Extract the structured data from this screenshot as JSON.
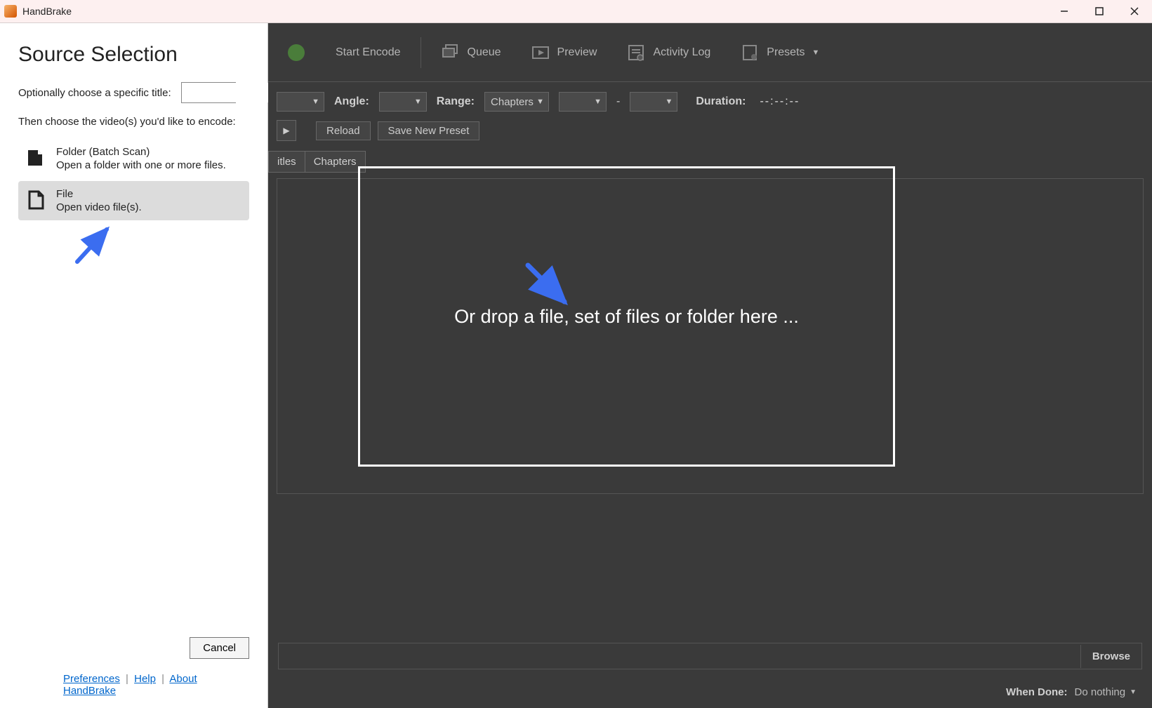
{
  "titlebar": {
    "title": "HandBrake"
  },
  "source": {
    "heading": "Source Selection",
    "title_label": "Optionally choose a specific title:",
    "instruction": "Then choose the video(s) you'd like to encode:",
    "folder": {
      "title": "Folder (Batch Scan)",
      "sub": "Open a folder with one or more files."
    },
    "file": {
      "title": "File",
      "sub": "Open video file(s)."
    },
    "cancel": "Cancel",
    "links": {
      "preferences": "Preferences",
      "help": "Help",
      "about": "About HandBrake"
    }
  },
  "toolbar": {
    "start": "Start Encode",
    "queue": "Queue",
    "preview": "Preview",
    "activity": "Activity Log",
    "presets": "Presets"
  },
  "controls": {
    "angle_label": "Angle:",
    "range_label": "Range:",
    "range_value": "Chapters",
    "duration_label": "Duration:",
    "duration_value": "--:--:--",
    "reload": "Reload",
    "save_preset": "Save New Preset"
  },
  "tabs": {
    "titles": "itles",
    "chapters": "Chapters"
  },
  "drop": {
    "text": "Or drop a file, set of files or folder here ..."
  },
  "bottom": {
    "browse": "Browse",
    "when_done_label": "When Done:",
    "when_done_value": "Do nothing"
  }
}
